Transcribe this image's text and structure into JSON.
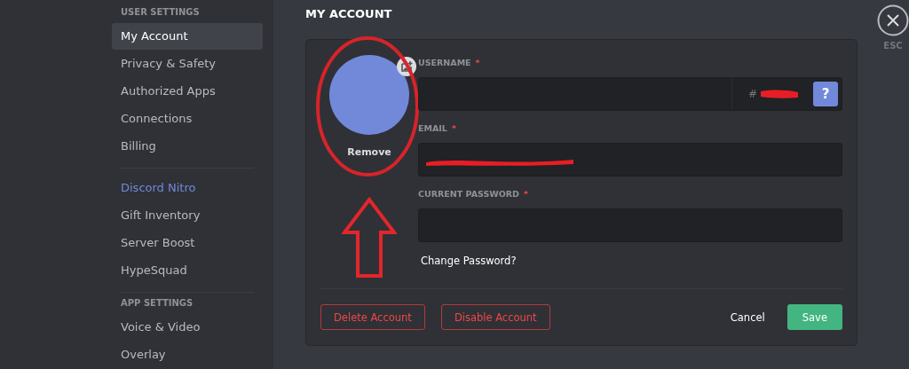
{
  "sidebar": {
    "sections": [
      {
        "header": "USER SETTINGS",
        "items": [
          {
            "label": "My Account",
            "selected": true,
            "kind": "normal"
          },
          {
            "label": "Privacy & Safety",
            "selected": false,
            "kind": "normal"
          },
          {
            "label": "Authorized Apps",
            "selected": false,
            "kind": "normal"
          },
          {
            "label": "Connections",
            "selected": false,
            "kind": "normal"
          },
          {
            "label": "Billing",
            "selected": false,
            "kind": "normal"
          }
        ]
      },
      {
        "items": [
          {
            "label": "Discord Nitro",
            "selected": false,
            "kind": "accent"
          },
          {
            "label": "Gift Inventory",
            "selected": false,
            "kind": "normal"
          },
          {
            "label": "Server Boost",
            "selected": false,
            "kind": "normal"
          },
          {
            "label": "HypeSquad",
            "selected": false,
            "kind": "normal"
          }
        ]
      },
      {
        "header": "APP SETTINGS",
        "items": [
          {
            "label": "Voice & Video",
            "selected": false,
            "kind": "normal"
          },
          {
            "label": "Overlay",
            "selected": false,
            "kind": "normal"
          }
        ]
      }
    ]
  },
  "page_title": "MY ACCOUNT",
  "avatar": {
    "remove_label": "Remove"
  },
  "fields": [
    {
      "label": "USERNAME",
      "required": "*",
      "kind": "username",
      "redacted": true,
      "discriminator": "#",
      "help": "?"
    },
    {
      "label": "EMAIL",
      "required": "*",
      "kind": "text",
      "redacted": true
    },
    {
      "label": "CURRENT PASSWORD",
      "required": "*",
      "kind": "text",
      "redacted": false
    }
  ],
  "change_password": "Change Password?",
  "buttons": [
    {
      "label": "Delete Account",
      "kind": "danger"
    },
    {
      "label": "Disable Account",
      "kind": "danger"
    },
    {
      "label": "Cancel",
      "kind": "link"
    },
    {
      "label": "Save",
      "kind": "primary"
    }
  ],
  "close": {
    "label": "ESC"
  }
}
